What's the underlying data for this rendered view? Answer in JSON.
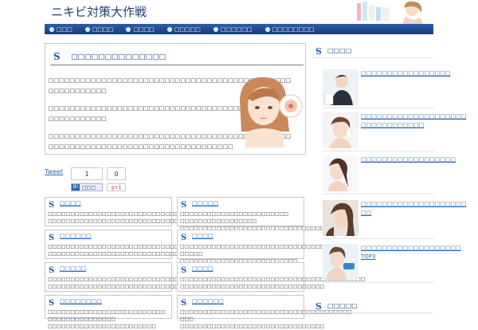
{
  "header": {
    "site_title": "ニキビ対策大作戦"
  },
  "nav": {
    "items": [
      {
        "label": "□□□"
      },
      {
        "label": "□□□□"
      },
      {
        "label": "□□□□"
      },
      {
        "label": "□□□□□"
      },
      {
        "label": "□□□□□□"
      },
      {
        "label": "□□□□□□□□"
      }
    ]
  },
  "article": {
    "title": "□□□□□□□□□□□□□□",
    "paragraphs": [
      {
        "line1": "□□□□□□□□□□□□□□□□□□□□□□□□□□□□□□□□□□□□□□□□□□□□□□",
        "line2": "□□□□□□□□□□□"
      },
      {
        "line1": "□□□□□□□□□□□□□□□□□□□□□□□□□□□□□□□□□□□□□□□□□□□□□□",
        "line2": "□□□□□□□□□□□"
      },
      {
        "line1": "□□□□□□□□□□□□□□□□□□□□□□□□□□□□□□□□□□□□□□□□□□□□□□",
        "line2": "□□□□□□□□□□□□□□□□□□□□□□□□□□□□□□□□□□□"
      }
    ]
  },
  "social": {
    "tweet_label": "Tweet",
    "tweet_count": "1",
    "like_count": "0",
    "hatena_b": "B!",
    "hatena_label": "□□□",
    "gplus_label": "g+1"
  },
  "cards": [
    {
      "title": "□□□□",
      "text1": "□□□□□□□□□□□□□□□□□□□□□□□□□□□□□□□□□□□□□□□□□",
      "text2": "□□□□□□□□□□□□□□□□□□□□□□□□□□□□□□□□□"
    },
    {
      "title": "□□□□□",
      "text1": "□□□□□□□□□□□□□□□□□□□□□□□□ □□□□□□□□□□□□□□□□□",
      "text2": "□□□□□□□□□□□□□□□□□□□□□□□□□□□□□□□□"
    },
    {
      "title": "□□□□□□",
      "text1": "□□□□□□□□□□□□□□□□□□□□□□□□□□□□□□□□□□□□□□□□",
      "text2": "□□□□□□□□□□□□□□□□□□□□□□□□□□□□□□□□"
    },
    {
      "title": "□□□□",
      "text1": "□□□□□□□□□□□□□□□□□□□□□□□□□□□□□□□□□□□□ □□□□□",
      "text2": "□□□□□□□□□□□□□□□□□□□□□□□□□□"
    },
    {
      "title": "□□□□□",
      "text1": "□□□□□□□□□□□□□□□□□□□□□□□□□□□□□□□□□□□□□□□□□",
      "text2": "□□□□□□□□□□□□□□□□□□□□□□□□□□□□□□"
    },
    {
      "title": "□□□□",
      "text1": "□□□□□□□□□□□□□□□□□□□□□□□□□□□□□□□□□□□□□□□□□",
      "text2": "□□□□□□□□□□□□□□□□□□□□□□□□□□□□□□□□"
    },
    {
      "title": "□□□□□□□□",
      "text1": "□□□□□□□□□□□□□□□□□□□□□□□□□□ □□□□□□□□□□□□□□□",
      "text2": "□□□□□□□□□□□□□□□□□□□□□□□□"
    },
    {
      "title": "□□□□□□",
      "text1": "□□□□□□□□□□□□□□□□□□□□□□□□□□□□□□□□□□□□□□ □□□",
      "text2": "□□□□□□□□□□□□□□□□□□□□□□□□□□□□□□□□"
    }
  ],
  "sidebar": {
    "section1_title": "□□□□",
    "items": [
      {
        "line1": "□□□□□□□□□□□□□□□□□",
        "line2": ""
      },
      {
        "line1": "□□□□□□□□□□□□□□□□□□□□",
        "line2": "□□□□□□□□□□□□"
      },
      {
        "line1": "□□□□□□□□□□□□□□□□□□",
        "line2": ""
      },
      {
        "line1": "□□□□□□□□□□□□□□□□□□□□",
        "line2": "□□"
      },
      {
        "line1": "□□□□□□□□□□□□□□□□□□□",
        "line2": "TOP3"
      }
    ],
    "section2_title": "□□□□□"
  }
}
